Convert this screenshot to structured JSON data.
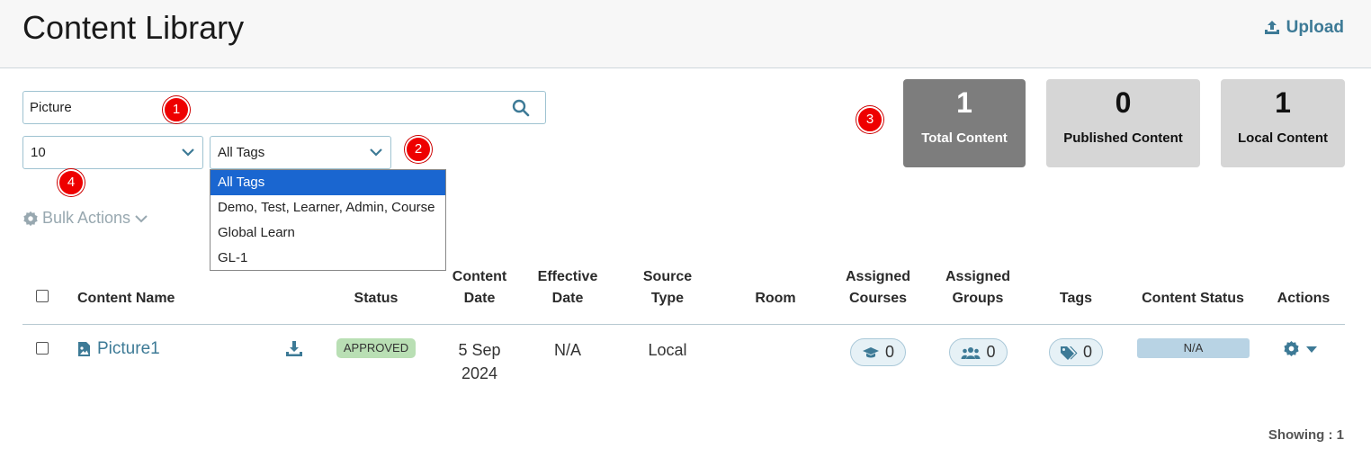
{
  "header": {
    "title": "Content Library",
    "upload_label": "Upload"
  },
  "search": {
    "value": "Picture",
    "placeholder": ""
  },
  "page_size_select": {
    "value": "10"
  },
  "tags_select": {
    "value": "All Tags",
    "options": [
      "All Tags",
      "Demo, Test, Learner, Admin, Course",
      "Global Learn",
      "GL-1"
    ]
  },
  "markers": [
    "1",
    "2",
    "3",
    "4"
  ],
  "stats": {
    "total": {
      "value": "1",
      "label": "Total Content"
    },
    "published": {
      "value": "0",
      "label": "Published Content"
    },
    "local": {
      "value": "1",
      "label": "Local Content"
    }
  },
  "bulk_actions_label": "Bulk Actions",
  "table": {
    "headers": {
      "content_name": "Content Name",
      "status": "Status",
      "content_date_1": "Content",
      "content_date_2": "Date",
      "effective_date_1": "Effective",
      "effective_date_2": "Date",
      "source_type_1": "Source",
      "source_type_2": "Type",
      "room": "Room",
      "assigned_courses_1": "Assigned",
      "assigned_courses_2": "Courses",
      "assigned_groups_1": "Assigned",
      "assigned_groups_2": "Groups",
      "tags": "Tags",
      "content_status": "Content Status",
      "actions": "Actions"
    },
    "rows": [
      {
        "name": "Picture1",
        "status": "APPROVED",
        "content_date_1": "5 Sep",
        "content_date_2": "2024",
        "effective_date": "N/A",
        "source_type": "Local",
        "room": "",
        "assigned_courses": "0",
        "assigned_groups": "0",
        "tags": "0",
        "content_status": "N/A"
      }
    ]
  },
  "footer": {
    "showing": "Showing : 1"
  },
  "colors": {
    "accent": "#3d7a96",
    "dropdown_selected": "#1a66d0",
    "approved_badge": "#b9dfb4",
    "total_card": "#7d7d7d",
    "marker": "#ee0000"
  }
}
